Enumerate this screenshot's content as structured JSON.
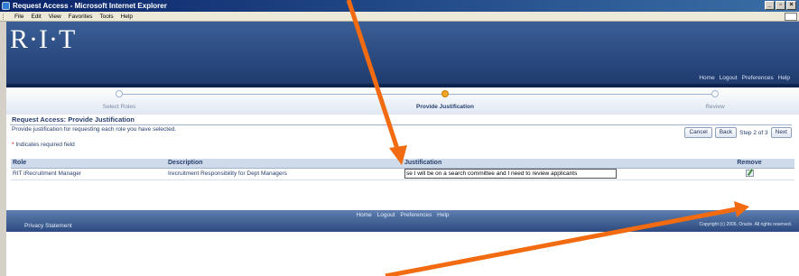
{
  "window": {
    "title": "Request Access - Microsoft Internet Explorer",
    "controls": [
      "_",
      "▫",
      "×"
    ]
  },
  "menubar": [
    "File",
    "Edit",
    "View",
    "Favorites",
    "Tools",
    "Help"
  ],
  "header": {
    "logo": "R·I·T",
    "links": [
      "Home",
      "Logout",
      "Preferences",
      "Help"
    ]
  },
  "train": {
    "steps": [
      {
        "label": "Select Roles",
        "state": "done"
      },
      {
        "label": "Provide Justification",
        "state": "current"
      },
      {
        "label": "Review",
        "state": "pending"
      }
    ]
  },
  "page": {
    "title": "Request Access: Provide Justification",
    "instructions": "Provide justification for requesting each role you have selected.",
    "required_note": "Indicates required field",
    "required_star": "*"
  },
  "nav": {
    "cancel": "Cancel",
    "back": "Back",
    "step": "Step 2 of 3",
    "next": "Next"
  },
  "table": {
    "headers": [
      "Role",
      "Description",
      "Justification",
      "Remove"
    ],
    "rows": [
      {
        "role": "RIT iRecruitment Manager",
        "description": "Irecruitment Responsibility for Dept Managers",
        "justification": "se I will be on a search committee and I need to review applicants"
      }
    ]
  },
  "footer": {
    "links": [
      "Home",
      "Logout",
      "Preferences",
      "Help"
    ],
    "privacy": "Privacy Statement",
    "copyright": "Copyright (c) 2006, Oracle. All rights reserved."
  },
  "colors": {
    "arrow": "#f26b10",
    "header": "#2a4a7f",
    "train_active": "#f5a623"
  }
}
